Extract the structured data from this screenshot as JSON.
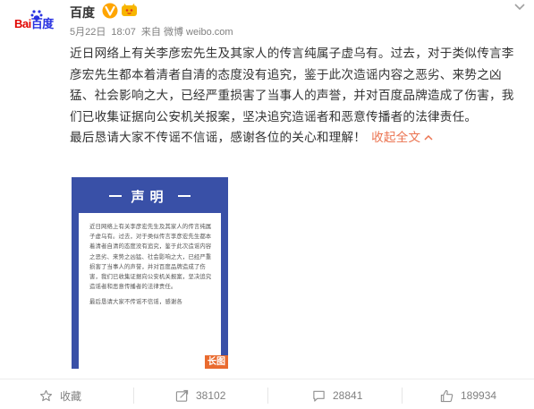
{
  "post": {
    "author": {
      "name": "百度",
      "avatar_logo_left": "Bai",
      "avatar_logo_right": "百度"
    },
    "meta": {
      "date": "5月22日",
      "time": "18:07",
      "source": "来自 微博 weibo.com"
    },
    "content": {
      "paragraph1": "近日网络上有关李彦宏先生及其家人的传言纯属子虚乌有。过去，对于类似传言李彦宏先生都本着清者自清的态度没有追究，鉴于此次造谣内容之恶劣、来势之凶猛、社会影响之大，已经严重损害了当事人的声誉，并对百度品牌造成了伤害，我们已收集证据向公安机关报案，坚决追究造谣者和恶意传播者的法律责任。",
      "paragraph2": "最后恳请大家不传谣不信谣，感谢各位的关心和理解！",
      "collapse_label": "收起全文"
    },
    "image": {
      "title": "声明",
      "body_p1": "近日网络上有关李彦宏先生及其家人的传言纯属子虚乌有。过去，对于类似传言李彦宏先生都本着清者自清的态度没有追究，鉴于此次造谣内容之恶劣、来势之凶猛、社会影响之大，已经严重损害了当事人的声誉，并对百度品牌造成了伤害，我们已收集证据向公安机关报案，坚决追究造谣者和恶意传播者的法律责任。",
      "body_p2": "最后恳请大家不传谣不信谣，感谢各",
      "badge": "长图"
    },
    "actions": {
      "favorite_label": "收藏",
      "repost_count": "38102",
      "comment_count": "28841",
      "like_count": "189934"
    }
  },
  "colors": {
    "accent": "#eb7350",
    "verified": "#ffa500",
    "statement_bg": "#3950a7",
    "muted": "#808080"
  },
  "icons": [
    "paw-icon",
    "verified-icon",
    "vip-icon",
    "chevron-down-icon",
    "star-icon",
    "repost-icon",
    "comment-icon",
    "like-icon"
  ]
}
